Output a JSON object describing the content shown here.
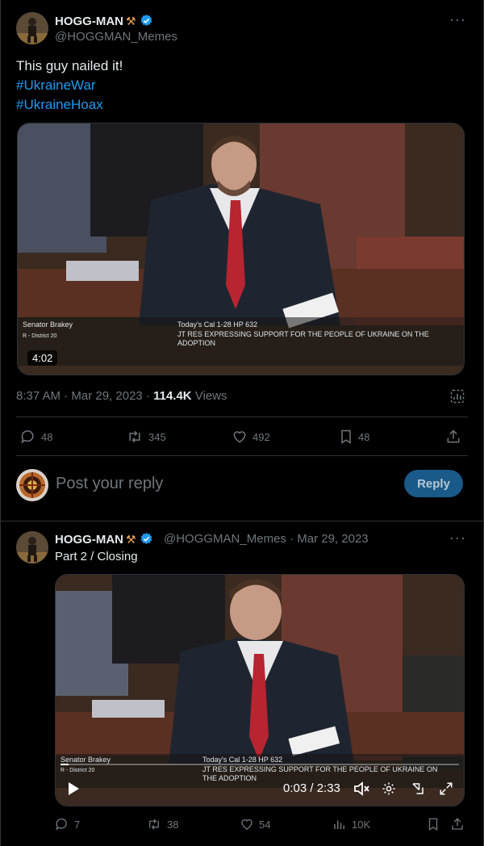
{
  "tweet": {
    "author_name": "HOGG-MAN",
    "author_emoji": "⚒",
    "author_handle": "@HOGGMAN_Memes",
    "more_label": "···",
    "text_line1": "This guy nailed it!",
    "hashtag1": "#UkraineWar",
    "hashtag2": "#UkraineHoax",
    "video": {
      "duration": "4:02",
      "chyron_name": "Senator Brakey",
      "chyron_district": "R - District 20",
      "chyron_cal": "Today's Cal  1-28  HP 632",
      "chyron_desc": "JT RES EXPRESSING SUPPORT FOR THE PEOPLE OF UKRAINE ON THE ADOPTION"
    },
    "timestamp": "8:37 AM · Mar 29, 2023 · ",
    "views_count": "114.4K",
    "views_label": " Views",
    "actions": {
      "replies": "48",
      "retweets": "345",
      "likes": "492",
      "bookmarks": "48"
    }
  },
  "reply_box": {
    "placeholder": "Post your reply",
    "button_label": "Reply"
  },
  "reply_tweet": {
    "author_name": "HOGG-MAN",
    "author_emoji": "⚒",
    "author_handle": "@HOGGMAN_Memes · Mar 29, 2023",
    "more_label": "···",
    "text": "Part 2 / Closing",
    "video": {
      "chyron_name": "Senator Brakey",
      "chyron_district": "R - District 20",
      "chyron_cal": "Today's Cal  1-28  HP 632",
      "chyron_desc": "JT RES EXPRESSING SUPPORT FOR THE PEOPLE OF UKRAINE ON THE ADOPTION",
      "time": "0:03 / 2:33",
      "progress_fraction": 0.02
    },
    "actions": {
      "replies": "7",
      "retweets": "38",
      "likes": "54",
      "views": "10K"
    }
  },
  "colors": {
    "accent": "#1d9bf0",
    "muted": "#71767b",
    "text": "#e7e9ea",
    "border": "#2f3336"
  }
}
